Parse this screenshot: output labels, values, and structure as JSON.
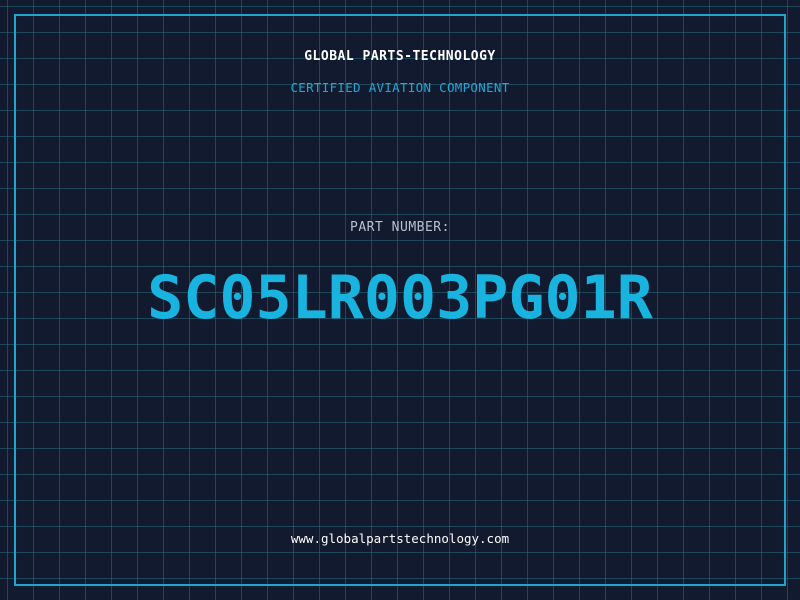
{
  "header": {
    "company": "GLOBAL PARTS-TECHNOLOGY",
    "subtitle": "CERTIFIED AVIATION COMPONENT"
  },
  "part": {
    "label": "PART NUMBER:",
    "number": "SC05LR003PG01R"
  },
  "footer": {
    "url": "www.globalpartstechnology.com"
  },
  "colors": {
    "background": "#111a2e",
    "grid": "#266e82",
    "frame": "#1fa6cf",
    "accent": "#18b3df",
    "text": "#ffffff",
    "muted": "#b9c2cf"
  }
}
